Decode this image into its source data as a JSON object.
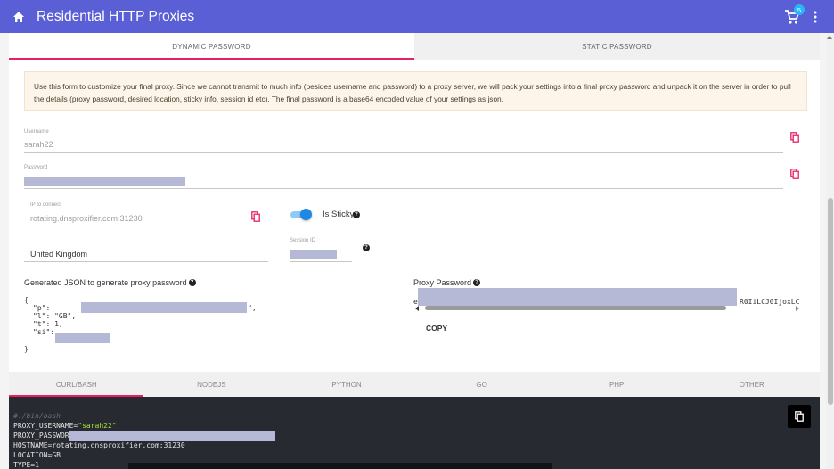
{
  "appbar": {
    "title": "Residential HTTP Proxies",
    "cart_count": "5",
    "icons": [
      "home-icon",
      "cart-icon",
      "more-vert-icon"
    ]
  },
  "tabs": {
    "dynamic": "DYNAMIC PASSWORD",
    "static": "STATIC PASSWORD"
  },
  "notice": "Use this form to customize your final proxy. Since we cannot transmit to much info (besides username and password) to a proxy server, we will pack your settings into a final proxy password and unpack it on the server in order to pull the details (proxy password, desired location, sticky info, session id etc). The final password is a base64 encoded value of your settings as json.",
  "form": {
    "username_label": "Username",
    "username_value": "sarah22",
    "password_label": "Password",
    "ip_label": "IP to connect",
    "ip_value": "rotating.dnsproxifier.com:31230",
    "sticky_label": "Is Sticky",
    "country_value": "United Kingdom",
    "session_label": "Session ID"
  },
  "json_section": {
    "heading": "Generated JSON to generate proxy password",
    "open": "{",
    "p_key": "\"p\":",
    "p_tail": "\",",
    "l_line": "\"l\": \"GB\",",
    "t_line": "\"t\": 1,",
    "si_key": "\"si\":",
    "close": "}"
  },
  "proxy_password": {
    "heading": "Proxy Password",
    "prefix": "e",
    "suffix": "R0IiLCJ0IjoxLC",
    "copy_label": "COPY"
  },
  "code_tabs": [
    "CURL/BASH",
    "NODEJS",
    "PYTHON",
    "GO",
    "PHP",
    "OTHER"
  ],
  "code": {
    "shebang": "#!/bin/bash",
    "user_prefix": "PROXY_USERNAME=",
    "user_value": "\"sarah22\"",
    "pass_prefix": "PROXY_PASSWORD=",
    "host_line": "HOSTNAME=rotating.dnsproxifier.com:31230",
    "loc_line": "LOCATION=GB",
    "type_line": "TYPE=1"
  },
  "colors": {
    "appbar": "#5a5fd6",
    "accent": "#e91e63",
    "toggle": "#1e88e5",
    "badge": "#29b6f6",
    "code_bg": "#272a30"
  }
}
